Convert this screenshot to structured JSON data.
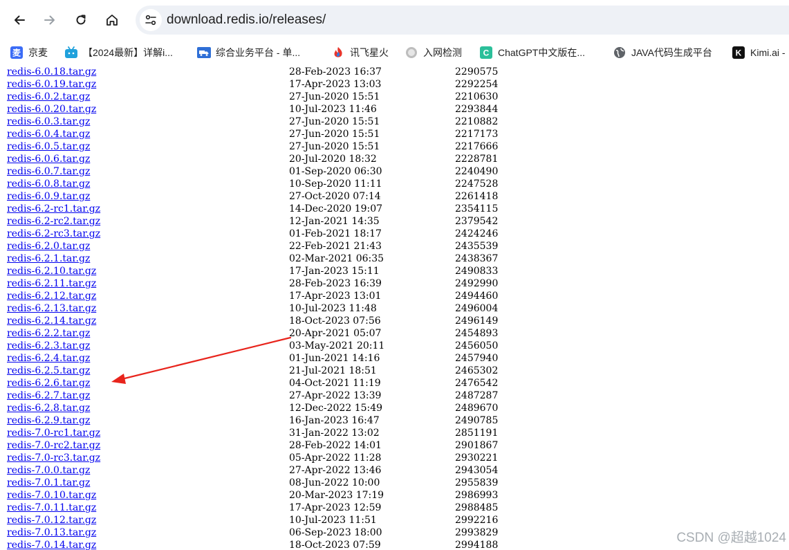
{
  "browser": {
    "address_url": "download.redis.io/releases/",
    "bookmarks": [
      {
        "label": "京麦",
        "icon": "jingmai-icon",
        "icon_color": "#3b6cf6",
        "icon_text": "麦"
      },
      {
        "label": "【2024最新】详解i...",
        "icon": "bilibili-icon",
        "icon_color": "#20a1dc",
        "icon_text": ""
      },
      {
        "label": "综合业务平台 - 单...",
        "icon": "truck-icon",
        "icon_color": "#2f6fd6",
        "icon_text": ""
      },
      {
        "label": "讯飞星火",
        "icon": "xinghuo-icon",
        "icon_color": "#e8352c",
        "icon_text": ""
      },
      {
        "label": "入网检测",
        "icon": "gray-badge-icon",
        "icon_color": "#bdbdbd",
        "icon_text": ""
      },
      {
        "label": "ChatGPT中文版在...",
        "icon": "chatgpt-icon",
        "icon_color": "#2bbf9a",
        "icon_text": "C"
      },
      {
        "label": "JAVA代码生成平台",
        "icon": "globe-icon",
        "icon_color": "#5f6368",
        "icon_text": ""
      },
      {
        "label": "Kimi.ai -",
        "icon": "kimi-icon",
        "icon_color": "#111111",
        "icon_text": "K"
      }
    ]
  },
  "files": [
    {
      "name": "redis-6.0.18.tar.gz",
      "date": "28-Feb-2023 16:37",
      "size": "2290575"
    },
    {
      "name": "redis-6.0.19.tar.gz",
      "date": "17-Apr-2023 13:03",
      "size": "2292254"
    },
    {
      "name": "redis-6.0.2.tar.gz",
      "date": "27-Jun-2020 15:51",
      "size": "2210630"
    },
    {
      "name": "redis-6.0.20.tar.gz",
      "date": "10-Jul-2023 11:46",
      "size": "2293844"
    },
    {
      "name": "redis-6.0.3.tar.gz",
      "date": "27-Jun-2020 15:51",
      "size": "2210882"
    },
    {
      "name": "redis-6.0.4.tar.gz",
      "date": "27-Jun-2020 15:51",
      "size": "2217173"
    },
    {
      "name": "redis-6.0.5.tar.gz",
      "date": "27-Jun-2020 15:51",
      "size": "2217666"
    },
    {
      "name": "redis-6.0.6.tar.gz",
      "date": "20-Jul-2020 18:32",
      "size": "2228781"
    },
    {
      "name": "redis-6.0.7.tar.gz",
      "date": "01-Sep-2020 06:30",
      "size": "2240490"
    },
    {
      "name": "redis-6.0.8.tar.gz",
      "date": "10-Sep-2020 11:11",
      "size": "2247528"
    },
    {
      "name": "redis-6.0.9.tar.gz",
      "date": "27-Oct-2020 07:14",
      "size": "2261418"
    },
    {
      "name": "redis-6.2-rc1.tar.gz",
      "date": "14-Dec-2020 19:07",
      "size": "2354115"
    },
    {
      "name": "redis-6.2-rc2.tar.gz",
      "date": "12-Jan-2021 14:35",
      "size": "2379542"
    },
    {
      "name": "redis-6.2-rc3.tar.gz",
      "date": "01-Feb-2021 18:17",
      "size": "2424246"
    },
    {
      "name": "redis-6.2.0.tar.gz",
      "date": "22-Feb-2021 21:43",
      "size": "2435539"
    },
    {
      "name": "redis-6.2.1.tar.gz",
      "date": "02-Mar-2021 06:35",
      "size": "2438367"
    },
    {
      "name": "redis-6.2.10.tar.gz",
      "date": "17-Jan-2023 15:11",
      "size": "2490833"
    },
    {
      "name": "redis-6.2.11.tar.gz",
      "date": "28-Feb-2023 16:39",
      "size": "2492990"
    },
    {
      "name": "redis-6.2.12.tar.gz",
      "date": "17-Apr-2023 13:01",
      "size": "2494460"
    },
    {
      "name": "redis-6.2.13.tar.gz",
      "date": "10-Jul-2023 11:48",
      "size": "2496004"
    },
    {
      "name": "redis-6.2.14.tar.gz",
      "date": "18-Oct-2023 07:56",
      "size": "2496149"
    },
    {
      "name": "redis-6.2.2.tar.gz",
      "date": "20-Apr-2021 05:07",
      "size": "2454893"
    },
    {
      "name": "redis-6.2.3.tar.gz",
      "date": "03-May-2021 20:11",
      "size": "2456050"
    },
    {
      "name": "redis-6.2.4.tar.gz",
      "date": "01-Jun-2021 14:16",
      "size": "2457940"
    },
    {
      "name": "redis-6.2.5.tar.gz",
      "date": "21-Jul-2021 18:51",
      "size": "2465302"
    },
    {
      "name": "redis-6.2.6.tar.gz",
      "date": "04-Oct-2021 11:19",
      "size": "2476542"
    },
    {
      "name": "redis-6.2.7.tar.gz",
      "date": "27-Apr-2022 13:39",
      "size": "2487287"
    },
    {
      "name": "redis-6.2.8.tar.gz",
      "date": "12-Dec-2022 15:49",
      "size": "2489670"
    },
    {
      "name": "redis-6.2.9.tar.gz",
      "date": "16-Jan-2023 16:47",
      "size": "2490785"
    },
    {
      "name": "redis-7.0-rc1.tar.gz",
      "date": "31-Jan-2022 13:02",
      "size": "2851191"
    },
    {
      "name": "redis-7.0-rc2.tar.gz",
      "date": "28-Feb-2022 14:01",
      "size": "2901867"
    },
    {
      "name": "redis-7.0-rc3.tar.gz",
      "date": "05-Apr-2022 11:28",
      "size": "2930221"
    },
    {
      "name": "redis-7.0.0.tar.gz",
      "date": "27-Apr-2022 13:46",
      "size": "2943054"
    },
    {
      "name": "redis-7.0.1.tar.gz",
      "date": "08-Jun-2022 10:00",
      "size": "2955839"
    },
    {
      "name": "redis-7.0.10.tar.gz",
      "date": "20-Mar-2023 17:19",
      "size": "2986993"
    },
    {
      "name": "redis-7.0.11.tar.gz",
      "date": "17-Apr-2023 12:59",
      "size": "2988485"
    },
    {
      "name": "redis-7.0.12.tar.gz",
      "date": "10-Jul-2023 11:51",
      "size": "2992216"
    },
    {
      "name": "redis-7.0.13.tar.gz",
      "date": "06-Sep-2023 18:00",
      "size": "2993829"
    },
    {
      "name": "redis-7.0.14.tar.gz",
      "date": "18-Oct-2023 07:59",
      "size": "2994188"
    }
  ],
  "annotation": {
    "color": "#e8241c",
    "points_to": "redis-6.2.6.tar.gz"
  },
  "watermark": "CSDN @超越1024"
}
